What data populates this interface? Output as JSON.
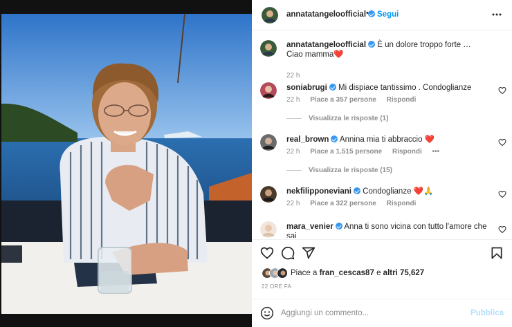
{
  "post": {
    "username": "annatatangeloofficial",
    "follow_label": "Segui",
    "separator": "•",
    "caption_line1": "È un dolore troppo forte …",
    "caption_line2": "Ciao mamma❤️",
    "caption_time": "22 h"
  },
  "comments": [
    {
      "username": "soniabrugi",
      "text": "Mi dispiace tantissimo . Condoglianze",
      "time": "22 h",
      "likes": "Piace a 357 persone",
      "reply": "Rispondi",
      "view_replies": "Visualizza le risposte (1)"
    },
    {
      "username": "real_brown",
      "text": "Annina mia ti abbraccio ❤️",
      "time": "22 h",
      "likes": "Piace a 1.515 persone",
      "reply": "Rispondi",
      "more": "•••",
      "view_replies": "Visualizza le risposte (15)"
    },
    {
      "username": "nekfilipponeviani",
      "text": "Condoglianze ❤️🙏",
      "time": "22 h",
      "likes": "Piace a 322 persone",
      "reply": "Rispondi"
    },
    {
      "username": "mara_venier",
      "text": "Anna ti sono vicina con tutto l'amore che sai",
      "text2": "❤️"
    }
  ],
  "likes_summary": {
    "prefix": "Piace a",
    "user": "fran_cescas87",
    "middle": "e",
    "others": "altri 75,627"
  },
  "post_time": "22 ORE FA",
  "add_comment": {
    "placeholder": "Aggiungi un commento...",
    "publish_label": "Pubblica"
  },
  "colors": {
    "link": "#0095f6",
    "verified": "#3897f0",
    "muted": "#8e8e8e"
  },
  "icons": [
    "verified-badge-icon",
    "more-icon",
    "heart-icon",
    "comment-icon",
    "share-icon",
    "bookmark-icon",
    "emoji-icon"
  ]
}
